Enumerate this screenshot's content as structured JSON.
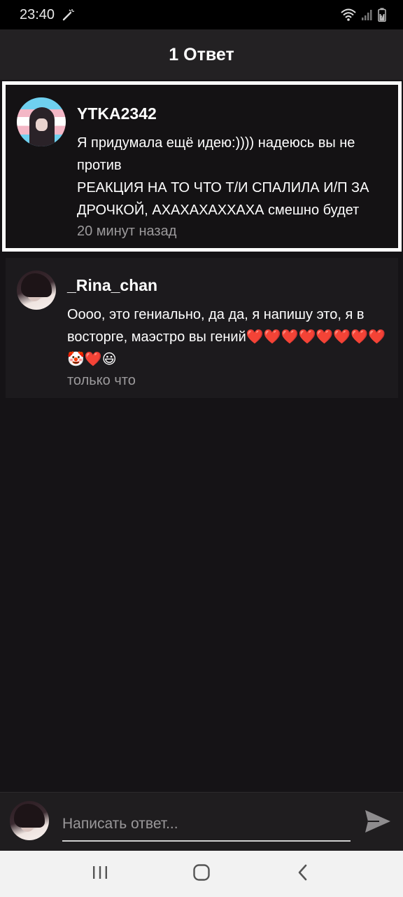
{
  "status_bar": {
    "time": "23:40",
    "icons": [
      "magic-wand-icon",
      "wifi-icon",
      "signal-icon",
      "battery-icon"
    ]
  },
  "header": {
    "title": "1 Ответ"
  },
  "parent_comment": {
    "username": "YTKA2342",
    "text": "Я придумала ещё идею:)))) надеюсь вы не против\nРЕАКЦИЯ НА ТО ЧТО Т/И СПАЛИЛА И/П ЗА ДРОЧКОЙ, АХАХАХАХХАХА смешно будет",
    "timestamp": "20 минут назад"
  },
  "reply_comment": {
    "username": "_Rina_chan",
    "text": "Оооо, это гениально, да да, я напишу это, я в восторге, маэстро вы гений❤️❤️❤️❤️❤️❤️❤️❤️🤡❤️😃",
    "timestamp": "только что"
  },
  "reply_bar": {
    "placeholder": "Написать ответ...",
    "value": ""
  },
  "nav_bar": {
    "items": [
      "recent-apps-icon",
      "home-icon",
      "back-icon"
    ]
  },
  "colors": {
    "background": "#151316",
    "header": "#232123",
    "highlight_border": "#ffffff",
    "timestamp": "#9c9a9c",
    "nav_bar": "#f2f2f2"
  }
}
